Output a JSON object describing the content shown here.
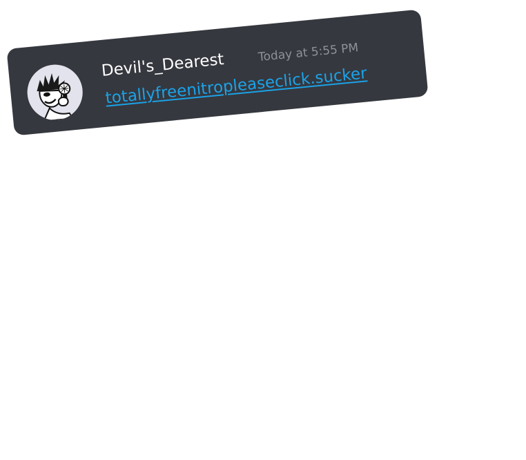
{
  "message": {
    "author": "Devil's_Dearest",
    "timestamp": "Today at 5:55 PM",
    "link_text": "totallyfreenitropleaseclick.sucker",
    "avatar_icon": "cartoon-character-with-microphone-avatar"
  },
  "colors": {
    "card_background": "#36383f",
    "username": "#ffffff",
    "timestamp": "#8e9198",
    "link": "#1aa3e8",
    "avatar_background": "#e2e3ec"
  }
}
